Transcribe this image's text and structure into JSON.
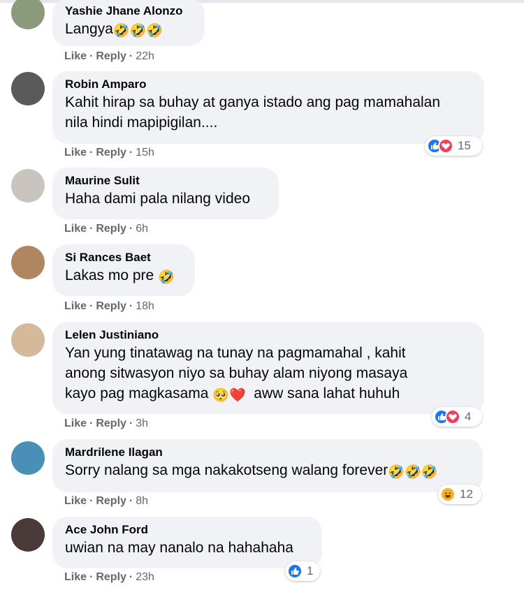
{
  "comments": [
    {
      "author": "Yashie Jhane Alonzo",
      "text": "Langya",
      "emoji": "🤣🤣🤣",
      "actions": {
        "like": "Like",
        "reply": "Reply",
        "time": "22h"
      },
      "reactions": null,
      "avatar_color": "#8a9a7a"
    },
    {
      "author": "Robin Amparo",
      "text": "Kahit hirap sa buhay at ganya istado ang pag mamahalan\nnila hindi mapipigilan....",
      "emoji": "",
      "actions": {
        "like": "Like",
        "reply": "Reply",
        "time": "15h"
      },
      "reactions": {
        "types": [
          "like",
          "love"
        ],
        "count": "15"
      },
      "avatar_color": "#5a5a5a"
    },
    {
      "author": "Maurine Sulit",
      "text": "Haha dami pala nilang video",
      "emoji": "",
      "actions": {
        "like": "Like",
        "reply": "Reply",
        "time": "6h"
      },
      "reactions": null,
      "avatar_color": "#c9c4be"
    },
    {
      "author": "Si Rances Baet",
      "text": "Lakas mo pre ",
      "emoji": "🤣",
      "actions": {
        "like": "Like",
        "reply": "Reply",
        "time": "18h"
      },
      "reactions": null,
      "avatar_color": "#b08560"
    },
    {
      "author": "Lelen Justiniano",
      "text": "Yan yung tinatawag na tunay na pagmamahal , kahit\nanong sitwasyon niyo sa buhay alam niyong masaya\nkayo pag magkasama ",
      "emoji": "🥺❤️",
      "text_after": "  aww sana lahat huhuh",
      "actions": {
        "like": "Like",
        "reply": "Reply",
        "time": "3h"
      },
      "reactions": {
        "types": [
          "like",
          "love"
        ],
        "count": "4"
      },
      "avatar_color": "#d4b99a"
    },
    {
      "author": "Mardrilene Ilagan",
      "text": "Sorry nalang sa mga nakakotseng walang forever",
      "emoji": "🤣🤣🤣",
      "actions": {
        "like": "Like",
        "reply": "Reply",
        "time": "8h"
      },
      "reactions": {
        "types": [
          "haha"
        ],
        "count": "12"
      },
      "avatar_color": "#4a8fb8"
    },
    {
      "author": "Ace John Ford",
      "text": "uwian na may nanalo na hahahaha",
      "emoji": "",
      "actions": {
        "like": "Like",
        "reply": "Reply",
        "time": "23h"
      },
      "reactions": {
        "types": [
          "like"
        ],
        "count": "1"
      },
      "avatar_color": "#4a3b3b"
    }
  ]
}
